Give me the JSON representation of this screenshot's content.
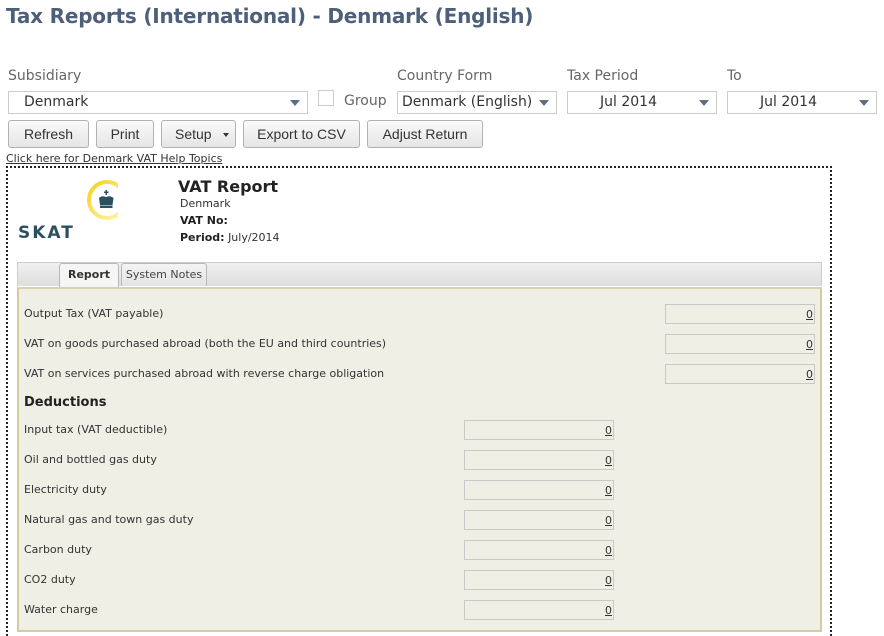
{
  "page_title": "Tax Reports (International) - Denmark (English)",
  "filters": {
    "subsidiary": {
      "label": "Subsidiary",
      "value": "Denmark"
    },
    "group": {
      "label": "Group",
      "checked": false
    },
    "country_form": {
      "label": "Country Form",
      "value": "Denmark (English)"
    },
    "tax_period": {
      "label": "Tax Period",
      "value": "Jul 2014"
    },
    "to": {
      "label": "To",
      "value": "Jul 2014"
    }
  },
  "toolbar": {
    "refresh": "Refresh",
    "print": "Print",
    "setup": "Setup",
    "export_csv": "Export to CSV",
    "adjust_return": "Adjust Return"
  },
  "help_link": "Click here for Denmark VAT Help Topics",
  "report": {
    "logo_text": "SKAT",
    "title": "VAT Report",
    "country": "Denmark",
    "vat_no_label": "VAT No:",
    "vat_no_value": "",
    "period_label": "Period:",
    "period_value": "July/2014"
  },
  "tabs": [
    {
      "label": "Report",
      "active": true
    },
    {
      "label": "System Notes",
      "active": false
    }
  ],
  "output_rows": [
    {
      "label": "Output Tax (VAT payable)",
      "value": "0"
    },
    {
      "label": "VAT on goods purchased abroad (both the EU and third countries)",
      "value": "0"
    },
    {
      "label": "VAT on services purchased abroad with reverse charge obligation",
      "value": "0"
    }
  ],
  "deductions": {
    "heading": "Deductions",
    "rows": [
      {
        "label": "Input tax (VAT deductible)",
        "value": "0"
      },
      {
        "label": "Oil and bottled gas duty",
        "value": "0"
      },
      {
        "label": "Electricity duty",
        "value": "0"
      },
      {
        "label": "Natural gas and town gas duty",
        "value": "0"
      },
      {
        "label": "Carbon duty",
        "value": "0"
      },
      {
        "label": "CO2 duty",
        "value": "0"
      },
      {
        "label": "Water charge",
        "value": "0"
      }
    ]
  }
}
